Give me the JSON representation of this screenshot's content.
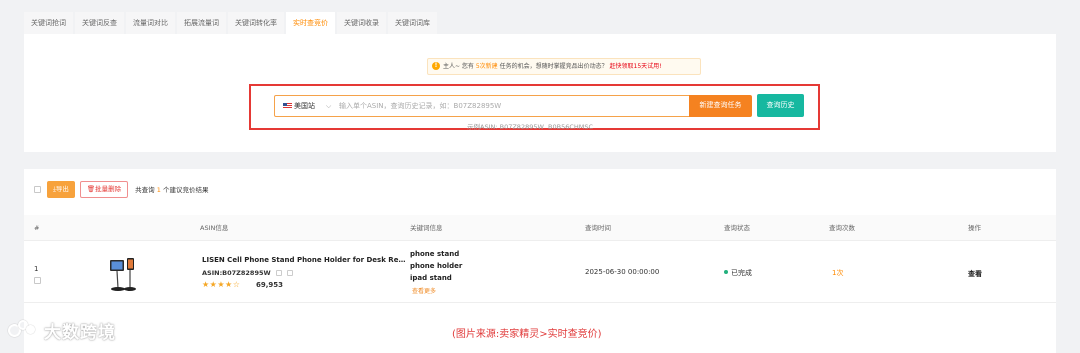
{
  "tabs": [
    {
      "label": "关键词抢词",
      "active": false
    },
    {
      "label": "关键词反查",
      "active": false
    },
    {
      "label": "流量词对比",
      "active": false
    },
    {
      "label": "拓展流量词",
      "active": false
    },
    {
      "label": "关键词转化率",
      "active": false
    },
    {
      "label": "实时查竞价",
      "active": true
    },
    {
      "label": "关键词收录",
      "active": false
    },
    {
      "label": "关键词词库",
      "active": false
    }
  ],
  "notice": {
    "prefix": "主人~ 您有",
    "count_text": "5次新建",
    "middle": "任务的机会，想随时掌握竞品出价动态？",
    "link": "赶快领取15天试用!"
  },
  "search": {
    "site": "美国站",
    "placeholder": "输入单个ASIN，查询历史记录，如：B07Z82895W",
    "value": "",
    "new_task_label": "新建查询任务",
    "history_label": "查询历史",
    "example_label": "示例ASIN:",
    "example_asins": "B07Z82895W  B0B56CHMSC"
  },
  "toolbar": {
    "export_label": "导出",
    "delete_label": "批量删除",
    "summary_prefix": "共查询",
    "summary_count": "1",
    "summary_suffix": "个建议竞价结果"
  },
  "table": {
    "headers": {
      "index": "#",
      "asin": "ASIN信息",
      "keywords": "关键词信息",
      "query_time": "查询时间",
      "status": "查询状态",
      "count": "查询次数",
      "actions": "操作"
    },
    "rows": [
      {
        "index": "1",
        "title": "LISEN Cell Phone Stand Phone Holder for Desk Recording...",
        "asin": "ASIN:B07Z82895W",
        "rating": 4.5,
        "stars": "★★★★☆",
        "reviews": "69,953",
        "keywords": [
          "phone stand",
          "phone holder",
          "ipad stand"
        ],
        "more_label": "查看更多",
        "query_time": "2025-06-30 00:00:00",
        "status": "已完成",
        "count": "1次",
        "action": "查看"
      }
    ]
  },
  "caption": "(图片来源:卖家精灵>实时查竞价)",
  "watermark": "大数跨境",
  "colors": {
    "accent": "#ff8a00",
    "new_task_button": "#f58220",
    "history_button": "#16b8a0",
    "highlight_box": "#e53935",
    "status_done": "#22b07d"
  }
}
